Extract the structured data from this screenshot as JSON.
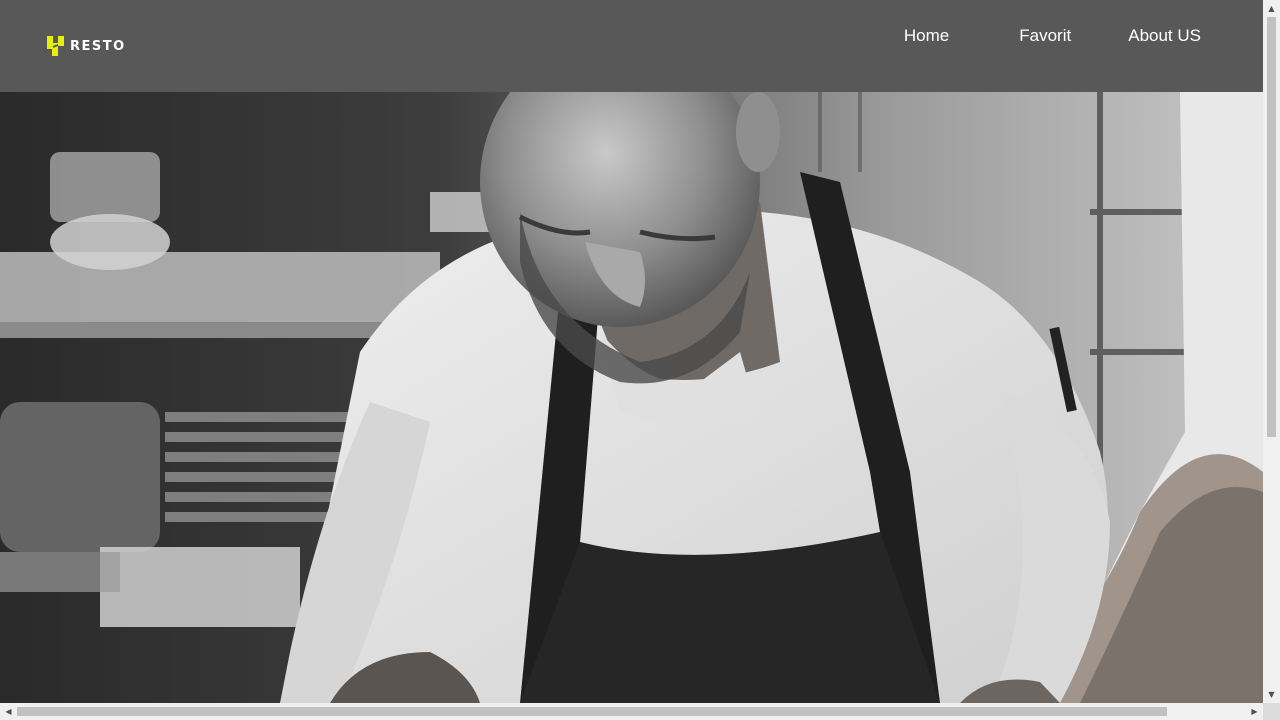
{
  "brand": {
    "name": "RESTO",
    "accent_color": "#e4f10f"
  },
  "nav": {
    "items": [
      {
        "label": "Home"
      },
      {
        "label": "Favorit"
      },
      {
        "label": "About US"
      }
    ]
  },
  "hero": {
    "image": "chef-cooking-grayscale-photo"
  },
  "colors": {
    "header_bg": "#585858",
    "nav_text": "#ffffff"
  }
}
